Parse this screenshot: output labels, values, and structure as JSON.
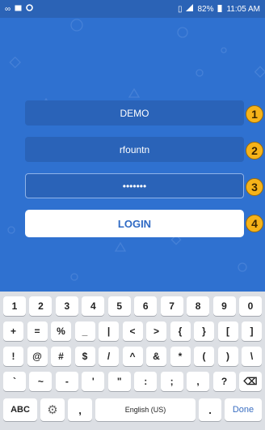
{
  "status": {
    "time": "11:05 AM",
    "battery": "82%",
    "icons_left": [
      "infinity-icon",
      "image-icon",
      "sync-icon"
    ],
    "icons_right": [
      "vibrate-icon",
      "signal-icon",
      "battery-icon"
    ]
  },
  "login_form": {
    "company_value": "DEMO",
    "username_value": "rfountn",
    "password_value": "•••••••",
    "login_label": "LOGIN"
  },
  "callouts": [
    "1",
    "2",
    "3",
    "4"
  ],
  "keyboard": {
    "row1": [
      "1",
      "2",
      "3",
      "4",
      "5",
      "6",
      "7",
      "8",
      "9",
      "0"
    ],
    "row2": [
      "+",
      "=",
      "%",
      "_",
      "|",
      "<",
      ">",
      "{",
      "}",
      "[",
      "]"
    ],
    "row3": [
      "!",
      "@",
      "#",
      "$",
      "/",
      "^",
      "&",
      "*",
      "(",
      ")",
      "\\"
    ],
    "row4": [
      "`",
      "~",
      "-",
      "'",
      "\"",
      ":",
      ";",
      ",",
      "?",
      "⌫"
    ],
    "abc_label": "ABC",
    "comma_label": ",",
    "space_label": "English (US)",
    "period_label": ".",
    "done_label": "Done"
  },
  "colors": {
    "app_background": "#2f71d0",
    "field_background": "#2a63b8",
    "badge": "#f6b319"
  }
}
